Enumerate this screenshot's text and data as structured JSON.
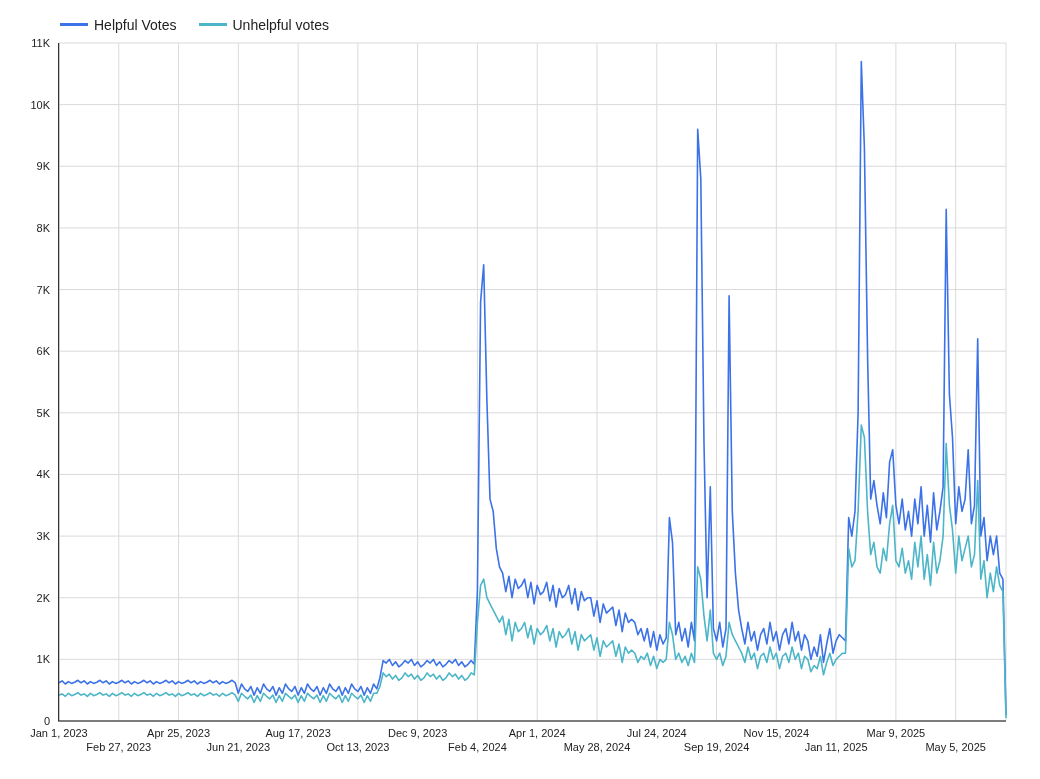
{
  "chart": {
    "chart_data": {
      "type": "line",
      "categories": [
        "Jan 1, 2023",
        null,
        null,
        null,
        null,
        null,
        null,
        null,
        null,
        null,
        null,
        null,
        null,
        null,
        null,
        null,
        null,
        null,
        null,
        "Feb 27, 2023",
        null,
        null,
        null,
        null,
        null,
        null,
        null,
        null,
        null,
        null,
        null,
        null,
        null,
        null,
        null,
        null,
        null,
        null,
        "Apr 25, 2023",
        null,
        null,
        null,
        null,
        null,
        null,
        null,
        null,
        null,
        null,
        null,
        null,
        null,
        null,
        null,
        null,
        null,
        null,
        "Jun 21, 2023",
        null,
        null,
        null,
        null,
        null,
        null,
        null,
        null,
        null,
        null,
        null,
        null,
        null,
        null,
        null,
        null,
        null,
        null,
        "Aug 17, 2023",
        null,
        null,
        null,
        null,
        null,
        null,
        null,
        null,
        null,
        null,
        null,
        null,
        null,
        null,
        null,
        null,
        null,
        null,
        "Oct 13, 2023",
        null,
        null,
        null,
        null,
        null,
        null,
        null,
        null,
        null,
        null,
        null,
        null,
        null,
        null,
        null,
        null,
        null,
        null,
        "Dec 9, 2023",
        null,
        null,
        null,
        null,
        null,
        null,
        null,
        null,
        null,
        null,
        null,
        null,
        null,
        null,
        null,
        null,
        null,
        null,
        "Feb 4, 2024",
        null,
        null,
        null,
        null,
        null,
        null,
        null,
        null,
        null,
        null,
        null,
        null,
        null,
        null,
        null,
        null,
        null,
        null,
        "Apr 1, 2024",
        null,
        null,
        null,
        null,
        null,
        null,
        null,
        null,
        null,
        null,
        null,
        null,
        null,
        null,
        null,
        null,
        null,
        null,
        "May 28, 2024",
        null,
        null,
        null,
        null,
        null,
        null,
        null,
        null,
        null,
        null,
        null,
        null,
        null,
        null,
        null,
        null,
        null,
        null,
        "Jul 24, 2024",
        null,
        null,
        null,
        null,
        null,
        null,
        null,
        null,
        null,
        null,
        null,
        null,
        null,
        null,
        null,
        null,
        null,
        null,
        "Sep 19, 2024",
        null,
        null,
        null,
        null,
        null,
        null,
        null,
        null,
        null,
        null,
        null,
        null,
        null,
        null,
        null,
        null,
        null,
        null,
        "Nov 15, 2024",
        null,
        null,
        null,
        null,
        null,
        null,
        null,
        null,
        null,
        null,
        null,
        null,
        null,
        null,
        null,
        null,
        null,
        null,
        "Jan 11, 2025",
        null,
        null,
        null,
        null,
        null,
        null,
        null,
        null,
        null,
        null,
        null,
        null,
        null,
        null,
        null,
        null,
        null,
        null,
        "Mar 9, 2025",
        null,
        null,
        null,
        null,
        null,
        null,
        null,
        null,
        null,
        null,
        null,
        null,
        null,
        null,
        null,
        null,
        null,
        null,
        "May 5, 2025",
        null,
        null,
        null,
        null,
        null,
        null,
        null,
        null,
        null,
        null,
        null,
        null,
        null,
        null,
        null,
        null
      ],
      "series": [
        {
          "name": "Helpful Votes",
          "color": "#3b72e8",
          "values": [
            620,
            650,
            600,
            640,
            610,
            630,
            660,
            620,
            650,
            600,
            640,
            610,
            630,
            660,
            620,
            650,
            600,
            640,
            610,
            630,
            660,
            620,
            650,
            600,
            640,
            610,
            630,
            660,
            620,
            650,
            600,
            640,
            610,
            630,
            660,
            620,
            650,
            600,
            640,
            610,
            630,
            660,
            620,
            650,
            600,
            640,
            610,
            630,
            660,
            620,
            650,
            600,
            640,
            610,
            630,
            660,
            620,
            450,
            600,
            520,
            480,
            560,
            420,
            540,
            450,
            600,
            520,
            480,
            560,
            420,
            540,
            450,
            600,
            520,
            480,
            560,
            420,
            540,
            450,
            600,
            520,
            480,
            560,
            420,
            540,
            450,
            600,
            520,
            480,
            560,
            420,
            540,
            450,
            600,
            520,
            480,
            560,
            420,
            540,
            450,
            600,
            520,
            700,
            980,
            940,
            1000,
            900,
            960,
            880,
            920,
            980,
            940,
            1000,
            900,
            960,
            880,
            920,
            980,
            940,
            1000,
            900,
            960,
            880,
            920,
            980,
            940,
            1000,
            900,
            960,
            880,
            920,
            980,
            920,
            2100,
            6800,
            7400,
            5200,
            3600,
            3400,
            2800,
            2500,
            2400,
            2100,
            2350,
            2000,
            2300,
            2150,
            2200,
            2300,
            2000,
            2250,
            1900,
            2200,
            2050,
            2100,
            2250,
            1950,
            2200,
            1850,
            2150,
            2000,
            2050,
            2200,
            1900,
            2150,
            1800,
            2100,
            1950,
            2000,
            2000,
            1700,
            1950,
            1600,
            1900,
            1750,
            1800,
            1850,
            1550,
            1800,
            1450,
            1750,
            1600,
            1650,
            1600,
            1400,
            1500,
            1300,
            1500,
            1200,
            1450,
            1150,
            1400,
            1250,
            1350,
            3300,
            2900,
            1400,
            1600,
            1300,
            1500,
            1200,
            1600,
            1300,
            9600,
            8800,
            4500,
            2000,
            3800,
            1500,
            1300,
            1600,
            1200,
            1500,
            6900,
            3400,
            2400,
            1800,
            1500,
            1250,
            1600,
            1300,
            1450,
            1150,
            1400,
            1500,
            1250,
            1600,
            1300,
            1450,
            1150,
            1400,
            1500,
            1250,
            1600,
            1300,
            1450,
            1150,
            1400,
            1300,
            1000,
            1200,
            1050,
            1400,
            950,
            1250,
            1500,
            1100,
            1300,
            1400,
            1350,
            1300,
            3300,
            3000,
            3400,
            5000,
            10700,
            9300,
            5900,
            3600,
            3900,
            3500,
            3200,
            3700,
            3300,
            4200,
            4400,
            3500,
            3200,
            3600,
            3100,
            3400,
            3000,
            3600,
            3200,
            3800,
            3000,
            3500,
            2900,
            3700,
            3100,
            3400,
            3800,
            8300,
            5300,
            4600,
            3200,
            3800,
            3400,
            3600,
            4400,
            3200,
            3500,
            6200,
            3000,
            3300,
            2600,
            3000,
            2700,
            3000,
            2400,
            2300,
            100
          ]
        },
        {
          "name": "Unhelpful votes",
          "color": "#4cb6c8",
          "values": [
            420,
            440,
            400,
            450,
            410,
            430,
            460,
            420,
            440,
            400,
            450,
            410,
            430,
            460,
            420,
            440,
            400,
            450,
            410,
            430,
            460,
            420,
            440,
            400,
            450,
            410,
            430,
            460,
            420,
            440,
            400,
            450,
            410,
            430,
            460,
            420,
            440,
            400,
            450,
            410,
            430,
            460,
            420,
            440,
            400,
            450,
            410,
            430,
            460,
            420,
            440,
            400,
            450,
            410,
            430,
            460,
            420,
            320,
            450,
            400,
            360,
            420,
            300,
            410,
            320,
            450,
            400,
            360,
            420,
            300,
            410,
            320,
            450,
            400,
            360,
            420,
            300,
            410,
            320,
            450,
            400,
            360,
            420,
            300,
            410,
            320,
            450,
            400,
            360,
            420,
            300,
            410,
            320,
            450,
            400,
            360,
            420,
            300,
            410,
            320,
            450,
            450,
            560,
            780,
            720,
            760,
            680,
            740,
            660,
            700,
            780,
            720,
            760,
            680,
            740,
            660,
            700,
            780,
            720,
            760,
            680,
            740,
            660,
            700,
            780,
            720,
            760,
            680,
            740,
            660,
            700,
            780,
            750,
            1600,
            2200,
            2300,
            2000,
            1900,
            1800,
            1700,
            1600,
            1700,
            1400,
            1650,
            1300,
            1600,
            1450,
            1500,
            1600,
            1350,
            1550,
            1250,
            1500,
            1400,
            1450,
            1550,
            1300,
            1500,
            1200,
            1450,
            1350,
            1400,
            1500,
            1250,
            1450,
            1150,
            1400,
            1300,
            1350,
            1400,
            1150,
            1350,
            1050,
            1300,
            1200,
            1250,
            1300,
            1050,
            1250,
            950,
            1200,
            1100,
            1150,
            1100,
            950,
            1050,
            1000,
            1100,
            900,
            1050,
            850,
            1000,
            950,
            1000,
            1600,
            1400,
            1000,
            1100,
            950,
            1050,
            900,
            1100,
            950,
            2500,
            2300,
            1700,
            1300,
            1800,
            1100,
            1000,
            1100,
            900,
            1050,
            1600,
            1400,
            1300,
            1200,
            1100,
            950,
            1200,
            1000,
            1100,
            850,
            1050,
            1100,
            950,
            1200,
            1000,
            1100,
            850,
            1050,
            1100,
            950,
            1200,
            1000,
            1100,
            850,
            1050,
            1000,
            800,
            900,
            850,
            1050,
            750,
            950,
            1100,
            900,
            1000,
            1050,
            1100,
            1100,
            2800,
            2500,
            2600,
            3400,
            4800,
            4600,
            3400,
            2700,
            2900,
            2500,
            2400,
            2800,
            2600,
            3200,
            3500,
            2600,
            2500,
            2800,
            2400,
            2600,
            2300,
            2900,
            2500,
            3000,
            2300,
            2700,
            2200,
            2900,
            2400,
            2600,
            3000,
            4500,
            3500,
            3100,
            2400,
            3000,
            2600,
            2800,
            3000,
            2500,
            2700,
            3900,
            2300,
            2600,
            2000,
            2400,
            2100,
            2500,
            2200,
            2100,
            50
          ]
        }
      ],
      "grid": true,
      "legend": "top",
      "ylim": [
        0,
        11000
      ],
      "yticks": [
        {
          "value": 0,
          "label": "0"
        },
        {
          "value": 1000,
          "label": "1K"
        },
        {
          "value": 2000,
          "label": "2K"
        },
        {
          "value": 3000,
          "label": "3K"
        },
        {
          "value": 4000,
          "label": "4K"
        },
        {
          "value": 5000,
          "label": "5K"
        },
        {
          "value": 6000,
          "label": "6K"
        },
        {
          "value": 7000,
          "label": "7K"
        },
        {
          "value": 8000,
          "label": "8K"
        },
        {
          "value": 9000,
          "label": "9K"
        },
        {
          "value": 10000,
          "label": "10K"
        },
        {
          "value": 11000,
          "label": "11K"
        }
      ]
    }
  }
}
